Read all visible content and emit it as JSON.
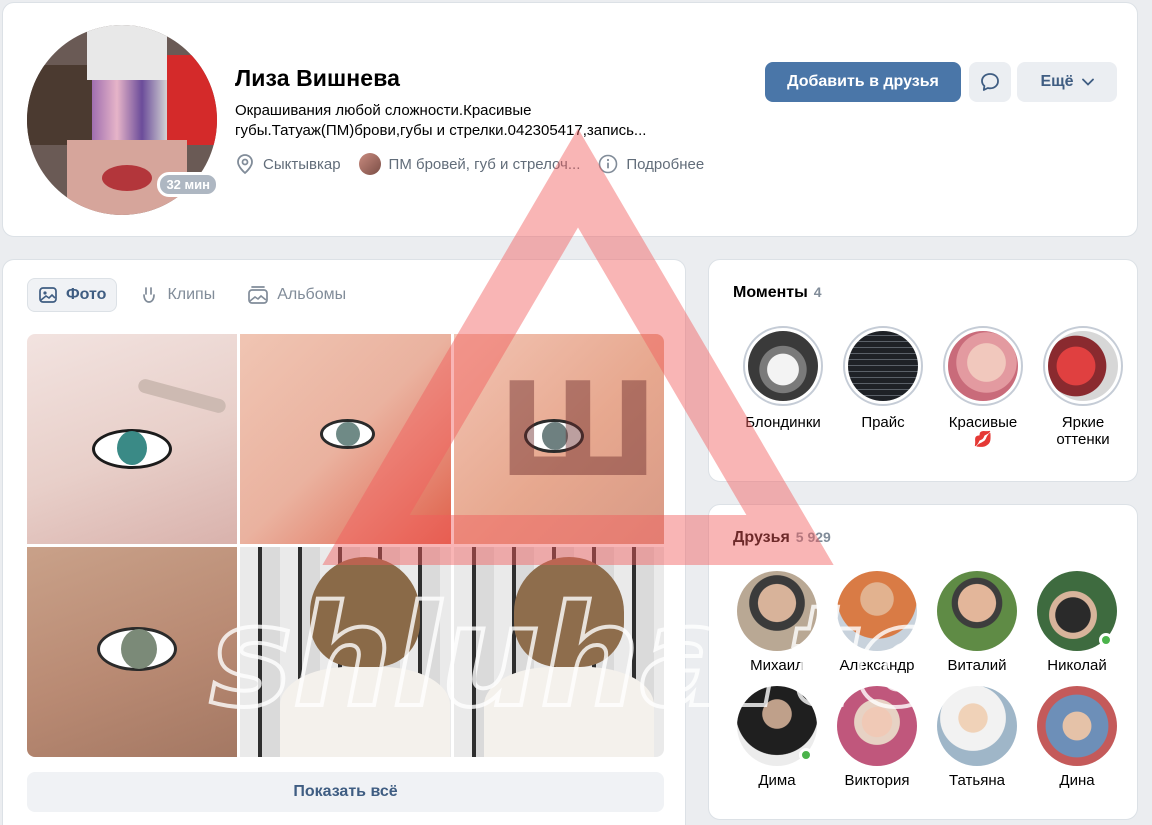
{
  "profile": {
    "name": "Лиза Вишнева",
    "bio": "Окрашивания любой сложности.Красивые губы.Татуаж(ПМ)брови,губы и стрелки.042305417,запись...",
    "status_time": "32 мин",
    "city": "Сыктывкар",
    "group": "ПМ бровей, губ и стрелоч...",
    "details": "Подробнее",
    "add_friend": "Добавить в друзья",
    "more": "Ещё"
  },
  "photos": {
    "tabs": [
      {
        "label": "Фото",
        "icon": "photo-icon",
        "active": true
      },
      {
        "label": "Клипы",
        "icon": "clips-icon",
        "active": false
      },
      {
        "label": "Альбомы",
        "icon": "albums-icon",
        "active": false
      }
    ],
    "show_all": "Показать всё"
  },
  "moments": {
    "title": "Моменты",
    "count": "4",
    "items": [
      {
        "label": "Блондинки",
        "color": "#d9dde2"
      },
      {
        "label": "Прайс",
        "color": "#1e2126"
      },
      {
        "label": "Красивые 💋",
        "color": "#e9b3aa"
      },
      {
        "label": "Яркие оттенки",
        "color": "#b53a45"
      }
    ]
  },
  "friends": {
    "title": "Друзья",
    "count": "5 929",
    "items": [
      {
        "name": "Михаил",
        "online": false,
        "color": "#8a7a6c"
      },
      {
        "name": "Александр",
        "online": false,
        "color": "#d97b45"
      },
      {
        "name": "Виталий",
        "online": false,
        "color": "#5f8b45"
      },
      {
        "name": "Николай",
        "online": true,
        "color": "#3e6b3f"
      },
      {
        "name": "Дима",
        "online": true,
        "color": "#3a3a3a"
      },
      {
        "name": "Виктория",
        "online": false,
        "color": "#c0577c"
      },
      {
        "name": "Татьяна",
        "online": false,
        "color": "#9fb6c8"
      },
      {
        "name": "Дина",
        "online": false,
        "color": "#6d8fb8"
      }
    ]
  },
  "watermark": {
    "logo_letter": "Ш",
    "text": "shluha.to"
  },
  "colors": {
    "accent": "#4a76a8",
    "link": "#3f5d82",
    "online": "#4bb34b"
  }
}
